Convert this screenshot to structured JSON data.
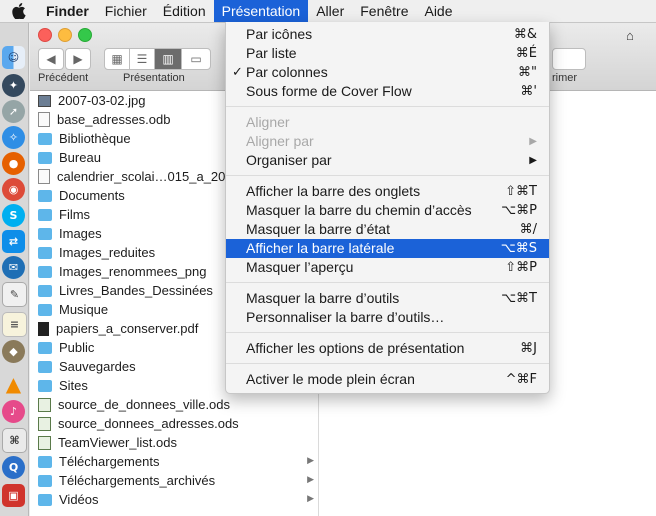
{
  "menubar": {
    "apple_icon": "apple-icon",
    "app_name": "Finder",
    "items": [
      "Fichier",
      "Édition",
      "Présentation",
      "Aller",
      "Fenêtre",
      "Aide"
    ]
  },
  "toolbar": {
    "back_label": "Précédent",
    "view_label": "Présentation",
    "trash_label_partial": "rimer"
  },
  "view_menu": {
    "items": [
      {
        "label": "Par icônes",
        "shortcut": "⌘&"
      },
      {
        "label": "Par liste",
        "shortcut": "⌘É"
      },
      {
        "label": "Par colonnes",
        "shortcut": "⌘\"",
        "checked": "✓"
      },
      {
        "label": "Sous forme de Cover Flow",
        "shortcut": "⌘'"
      },
      {
        "label": "Aligner",
        "disabled": true
      },
      {
        "label": "Aligner par",
        "submenu": "▶",
        "disabled": true
      },
      {
        "label": "Organiser par",
        "submenu": "▶"
      },
      {
        "label": "Afficher la barre des onglets",
        "shortcut": "⇧⌘T"
      },
      {
        "label": "Masquer la barre du chemin d’accès",
        "shortcut": "⌥⌘P"
      },
      {
        "label": "Masquer la barre d’état",
        "shortcut": "⌘/"
      },
      {
        "label": "Afficher la barre latérale",
        "shortcut": "⌥⌘S",
        "highlighted": true
      },
      {
        "label": "Masquer l’aperçu",
        "shortcut": "⇧⌘P"
      },
      {
        "label": "Masquer la barre d’outils",
        "shortcut": "⌥⌘T"
      },
      {
        "label": "Personnaliser la barre d’outils…"
      },
      {
        "label": "Afficher les options de présentation",
        "shortcut": "⌘J"
      },
      {
        "label": "Activer le mode plein écran",
        "shortcut": "^⌘F"
      }
    ]
  },
  "files": [
    {
      "name": "2007-03-02.jpg",
      "type": "img"
    },
    {
      "name": "base_adresses.odb",
      "type": "doc"
    },
    {
      "name": "Bibliothèque",
      "type": "folder"
    },
    {
      "name": "Bureau",
      "type": "folder"
    },
    {
      "name": "calendrier_scolai…015_a_20",
      "type": "doc"
    },
    {
      "name": "Documents",
      "type": "folder"
    },
    {
      "name": "Films",
      "type": "folder"
    },
    {
      "name": "Images",
      "type": "folder"
    },
    {
      "name": "Images_reduites",
      "type": "folder"
    },
    {
      "name": "Images_renommees_png",
      "type": "folder"
    },
    {
      "name": "Livres_Bandes_Dessinées",
      "type": "folder"
    },
    {
      "name": "Musique",
      "type": "folder"
    },
    {
      "name": "papiers_a_conserver.pdf",
      "type": "pdf"
    },
    {
      "name": "Public",
      "type": "folder"
    },
    {
      "name": "Sauvegardes",
      "type": "folder"
    },
    {
      "name": "Sites",
      "type": "folder"
    },
    {
      "name": "source_de_donnees_ville.ods",
      "type": "sheet"
    },
    {
      "name": "source_donnees_adresses.ods",
      "type": "sheet"
    },
    {
      "name": "TeamViewer_list.ods",
      "type": "sheet"
    },
    {
      "name": "Téléchargements",
      "type": "folder",
      "chevron": "▶"
    },
    {
      "name": "Téléchargements_archivés",
      "type": "folder",
      "chevron": "▶"
    },
    {
      "name": "Vidéos",
      "type": "folder",
      "chevron": "▶"
    }
  ],
  "dock_icons": [
    "finder-icon",
    "launchpad-icon",
    "rocket-icon",
    "safari-icon",
    "firefox-icon",
    "chrome-icon",
    "skype-icon",
    "teamviewer-icon",
    "thunderbird-icon",
    "textedit-icon",
    "notes-icon",
    "gimp-icon",
    "vlc-icon",
    "itunes-icon",
    "remote-icon",
    "quicktime-icon",
    "presentation-icon"
  ]
}
